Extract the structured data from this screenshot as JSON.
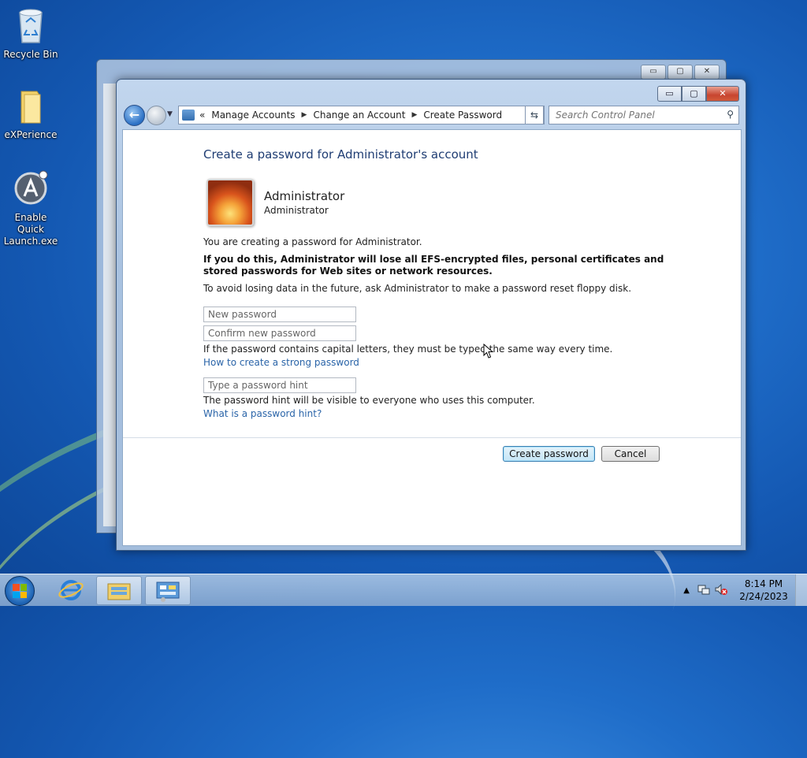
{
  "desktop": {
    "icons": [
      {
        "label": "Recycle Bin"
      },
      {
        "label": "eXPerience"
      },
      {
        "label": "Enable Quick Launch.exe"
      }
    ]
  },
  "window": {
    "nav": {
      "breadcrumbs": [
        "Manage Accounts",
        "Change an Account",
        "Create Password"
      ],
      "search_placeholder": "Search Control Panel"
    },
    "title_buttons": {
      "minimize": "▭",
      "maximize": "▢",
      "close": "✕"
    },
    "content": {
      "heading": "Create a password for Administrator's account",
      "user_name": "Administrator",
      "user_role": "Administrator",
      "intro": "You are creating a password for Administrator.",
      "warning": "If you do this, Administrator will lose all EFS-encrypted files, personal certificates and stored passwords for Web sites or network resources.",
      "advice": "To avoid losing data in the future, ask Administrator to make a password reset floppy disk.",
      "new_password_placeholder": "New password",
      "confirm_password_placeholder": "Confirm new password",
      "case_note": "If the password contains capital letters, they must be typed the same way every time.",
      "strong_password_link": "How to create a strong password",
      "hint_placeholder": "Type a password hint",
      "hint_note": "The password hint will be visible to everyone who uses this computer.",
      "hint_link": "What is a password hint?",
      "create_button": "Create password",
      "cancel_button": "Cancel"
    }
  },
  "taskbar": {
    "time": "8:14 PM",
    "date": "2/24/2023"
  }
}
